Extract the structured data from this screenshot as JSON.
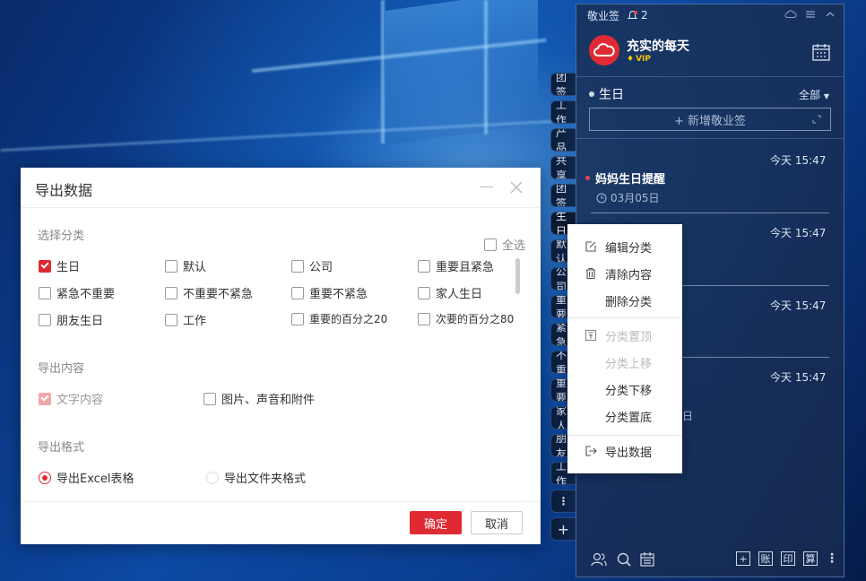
{
  "dialog": {
    "title": "导出数据",
    "section_category": "选择分类",
    "select_all": "全选",
    "categories": [
      {
        "label": "生日",
        "checked": true
      },
      {
        "label": "默认",
        "checked": false
      },
      {
        "label": "公司",
        "checked": false
      },
      {
        "label": "重要且紧急",
        "checked": false
      },
      {
        "label": "紧急不重要",
        "checked": false
      },
      {
        "label": "不重要不紧急",
        "checked": false
      },
      {
        "label": "重要不紧急",
        "checked": false
      },
      {
        "label": "家人生日",
        "checked": false
      },
      {
        "label": "朋友生日",
        "checked": false
      },
      {
        "label": "工作",
        "checked": false
      },
      {
        "label": "重要的百分之20",
        "checked": false
      },
      {
        "label": "次要的百分之80",
        "checked": false
      }
    ],
    "section_content": "导出内容",
    "content_text": "文字内容",
    "content_media": "图片、声音和附件",
    "section_format": "导出格式",
    "format_excel": "导出Excel表格",
    "format_folder": "导出文件夹格式",
    "ok": "确定",
    "cancel": "取消"
  },
  "side_tabs": [
    "团签",
    "工作",
    "产品",
    "共享",
    "团签",
    "生日",
    "默认",
    "公司",
    "重要",
    "紧急",
    "不重",
    "重要",
    "家人",
    "朋友",
    "工作"
  ],
  "side_more": "⋮",
  "side_add": "+",
  "panel": {
    "app_name": "敬业签",
    "notification_count": "2",
    "username": "充实的每天",
    "vip": "VIP",
    "category": "生日",
    "filter": "全部",
    "add_note": "+ 新增敬业签",
    "notes": [
      {
        "time": "今天 15:47",
        "title": "妈妈生日提醒",
        "date": "03月05日"
      },
      {
        "time": "今天 15:47",
        "title": "",
        "date": ""
      },
      {
        "time": "今天 15:47",
        "title": "",
        "date": ""
      },
      {
        "time": "今天 15:47",
        "title": "",
        "date": "日"
      }
    ],
    "bottom_buttons": [
      "+",
      "账",
      "印",
      "算"
    ]
  },
  "context_menu": {
    "items": [
      {
        "label": "编辑分类",
        "icon": "edit-icon",
        "disabled": false
      },
      {
        "label": "清除内容",
        "icon": "trash-icon",
        "disabled": false
      },
      {
        "label": "删除分类",
        "icon": "",
        "disabled": false
      },
      {
        "label": "分类置顶",
        "icon": "pin-top-icon",
        "disabled": true
      },
      {
        "label": "分类上移",
        "icon": "",
        "disabled": true
      },
      {
        "label": "分类下移",
        "icon": "",
        "disabled": false
      },
      {
        "label": "分类置底",
        "icon": "",
        "disabled": false
      },
      {
        "label": "导出数据",
        "icon": "export-icon",
        "disabled": false
      }
    ]
  },
  "colors": {
    "accent": "#e02a33",
    "panel": "#192d50"
  }
}
